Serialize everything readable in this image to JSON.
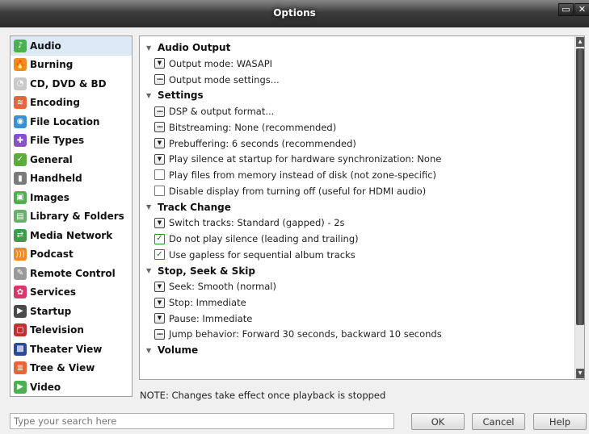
{
  "window": {
    "title": "Options",
    "maximize_glyph": "▭",
    "close_glyph": "✕"
  },
  "sidebar": {
    "items": [
      {
        "label": "Audio",
        "icon": "audio-icon",
        "color": "#4caf50",
        "glyph": "♪",
        "selected": true
      },
      {
        "label": "Burning",
        "icon": "flame-icon",
        "color": "#f08c1a",
        "glyph": "🔥",
        "selected": false
      },
      {
        "label": "CD, DVD & BD",
        "icon": "disc-icon",
        "color": "#c9c9c9",
        "glyph": "◔",
        "selected": false
      },
      {
        "label": "Encoding",
        "icon": "encoding-icon",
        "color": "#e8643a",
        "glyph": "≋",
        "selected": false
      },
      {
        "label": "File Location",
        "icon": "globe-icon",
        "color": "#3a8fd9",
        "glyph": "◉",
        "selected": false
      },
      {
        "label": "File Types",
        "icon": "puzzle-icon",
        "color": "#8a4fcf",
        "glyph": "✚",
        "selected": false
      },
      {
        "label": "General",
        "icon": "general-icon",
        "color": "#5aac3e",
        "glyph": "✓",
        "selected": false
      },
      {
        "label": "Handheld",
        "icon": "handheld-icon",
        "color": "#7a7a7a",
        "glyph": "▮",
        "selected": false
      },
      {
        "label": "Images",
        "icon": "images-icon",
        "color": "#4caf50",
        "glyph": "▣",
        "selected": false
      },
      {
        "label": "Library & Folders",
        "icon": "library-icon",
        "color": "#68b06a",
        "glyph": "▤",
        "selected": false
      },
      {
        "label": "Media Network",
        "icon": "network-icon",
        "color": "#3f9a4a",
        "glyph": "⇄",
        "selected": false
      },
      {
        "label": "Podcast",
        "icon": "podcast-icon",
        "color": "#f08a24",
        "glyph": ")))",
        "selected": false
      },
      {
        "label": "Remote Control",
        "icon": "remote-icon",
        "color": "#9a9a9a",
        "glyph": "✎",
        "selected": false
      },
      {
        "label": "Services",
        "icon": "services-icon",
        "color": "#d9366b",
        "glyph": "✿",
        "selected": false
      },
      {
        "label": "Startup",
        "icon": "startup-icon",
        "color": "#4a4a4a",
        "glyph": "▶",
        "selected": false
      },
      {
        "label": "Television",
        "icon": "television-icon",
        "color": "#c23030",
        "glyph": "▢",
        "selected": false
      },
      {
        "label": "Theater View",
        "icon": "theater-icon",
        "color": "#2a4a9a",
        "glyph": "▩",
        "selected": false
      },
      {
        "label": "Tree & View",
        "icon": "tree-icon",
        "color": "#e8643a",
        "glyph": "≣",
        "selected": false
      },
      {
        "label": "Video",
        "icon": "video-icon",
        "color": "#4caf50",
        "glyph": "▶",
        "selected": false
      }
    ]
  },
  "sections": [
    {
      "title": "Audio Output",
      "rows": [
        {
          "type": "dropdown",
          "label": "Output mode: WASAPI"
        },
        {
          "type": "ellipsis",
          "label": "Output mode settings..."
        }
      ]
    },
    {
      "title": "Settings",
      "rows": [
        {
          "type": "ellipsis",
          "label": "DSP & output format..."
        },
        {
          "type": "ellipsis",
          "label": "Bitstreaming: None (recommended)"
        },
        {
          "type": "dropdown",
          "label": "Prebuffering: 6 seconds (recommended)"
        },
        {
          "type": "dropdown",
          "label": "Play silence at startup for hardware synchronization: None"
        },
        {
          "type": "checkbox",
          "checked": false,
          "label": "Play files from memory instead of disk (not zone-specific)"
        },
        {
          "type": "checkbox",
          "checked": false,
          "label": "Disable display from turning off (useful for HDMI audio)"
        }
      ]
    },
    {
      "title": "Track Change",
      "rows": [
        {
          "type": "dropdown",
          "label": "Switch tracks: Standard (gapped) - 2s"
        },
        {
          "type": "checkbox",
          "checked": true,
          "label": "Do not play silence (leading and trailing)"
        },
        {
          "type": "checkbox",
          "checked": true,
          "label": "Use gapless for sequential album tracks"
        }
      ]
    },
    {
      "title": "Stop, Seek & Skip",
      "rows": [
        {
          "type": "dropdown",
          "label": "Seek: Smooth (normal)"
        },
        {
          "type": "dropdown",
          "label": "Stop: Immediate"
        },
        {
          "type": "dropdown",
          "label": "Pause: Immediate"
        },
        {
          "type": "ellipsis",
          "label": "Jump behavior: Forward 30 seconds, backward 10 seconds"
        }
      ]
    },
    {
      "title": "Volume",
      "rows": []
    }
  ],
  "glyphs": {
    "section_arrow": "▼",
    "dropdown": "▼",
    "ellipsis": "...",
    "check": "✓",
    "scroll_up": "▲",
    "scroll_down": "▼"
  },
  "note": "NOTE: Changes take effect once playback is stopped",
  "footer": {
    "search_placeholder": "Type your search here",
    "ok_label": "OK",
    "cancel_label": "Cancel",
    "help_label": "Help"
  }
}
